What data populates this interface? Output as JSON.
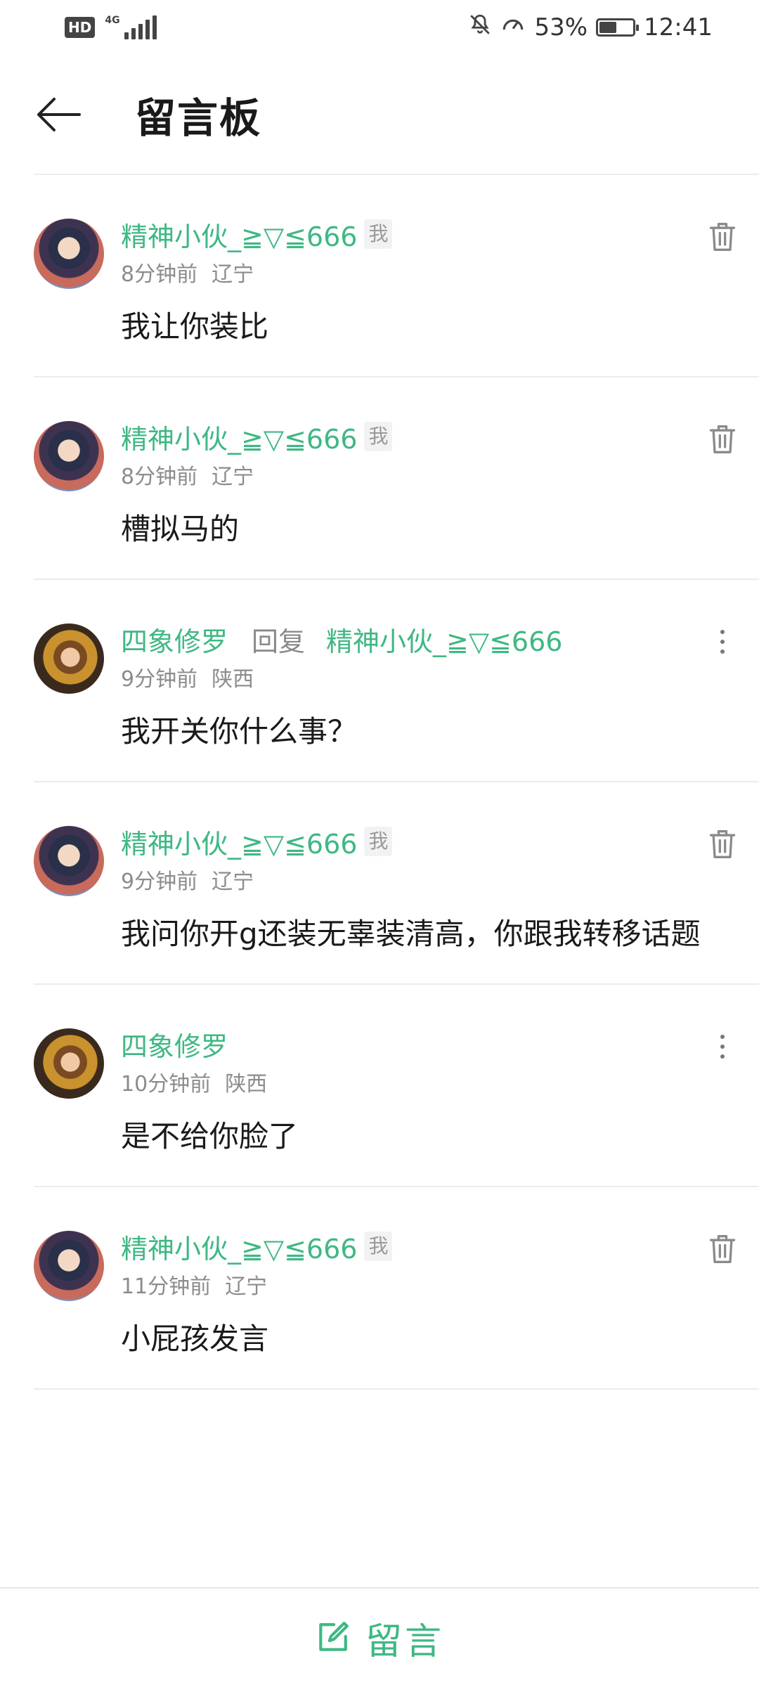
{
  "status_bar": {
    "hd": "HD",
    "network": "4G",
    "battery_percent_text": "53%",
    "battery_level": 0.53,
    "time": "12:41"
  },
  "header": {
    "title": "留言板"
  },
  "comments": [
    {
      "author": "精神小伙_≧▽≦666",
      "me_tag": "我",
      "time": "8分钟前",
      "location": "辽宁",
      "text": "我让你装比",
      "action_icon": "trash-icon"
    },
    {
      "author": "精神小伙_≧▽≦666",
      "me_tag": "我",
      "time": "8分钟前",
      "location": "辽宁",
      "text": "槽拟马的",
      "action_icon": "trash-icon"
    },
    {
      "author": "四象修罗",
      "reply_word": "回复",
      "reply_to": "精神小伙_≧▽≦666",
      "time": "9分钟前",
      "location": "陕西",
      "text": "我开关你什么事？",
      "action_icon": "more-vertical-icon"
    },
    {
      "author": "精神小伙_≧▽≦666",
      "me_tag": "我",
      "time": "9分钟前",
      "location": "辽宁",
      "text": "我问你开g还装无辜装清高，你跟我转移话题",
      "action_icon": "trash-icon"
    },
    {
      "author": "四象修罗",
      "time": "10分钟前",
      "location": "陕西",
      "text": "是不给你脸了",
      "action_icon": "more-vertical-icon"
    },
    {
      "author": "精神小伙_≧▽≦666",
      "me_tag": "我",
      "time": "11分钟前",
      "location": "辽宁",
      "text": "小屁孩发言",
      "action_icon": "trash-icon"
    }
  ],
  "bottom_bar": {
    "compose_label": "留言",
    "compose_icon": "edit-icon"
  },
  "colors": {
    "accent": "#3fb883",
    "text": "#1a1a1a",
    "meta": "#8c8c8c",
    "divider": "#ececec"
  }
}
